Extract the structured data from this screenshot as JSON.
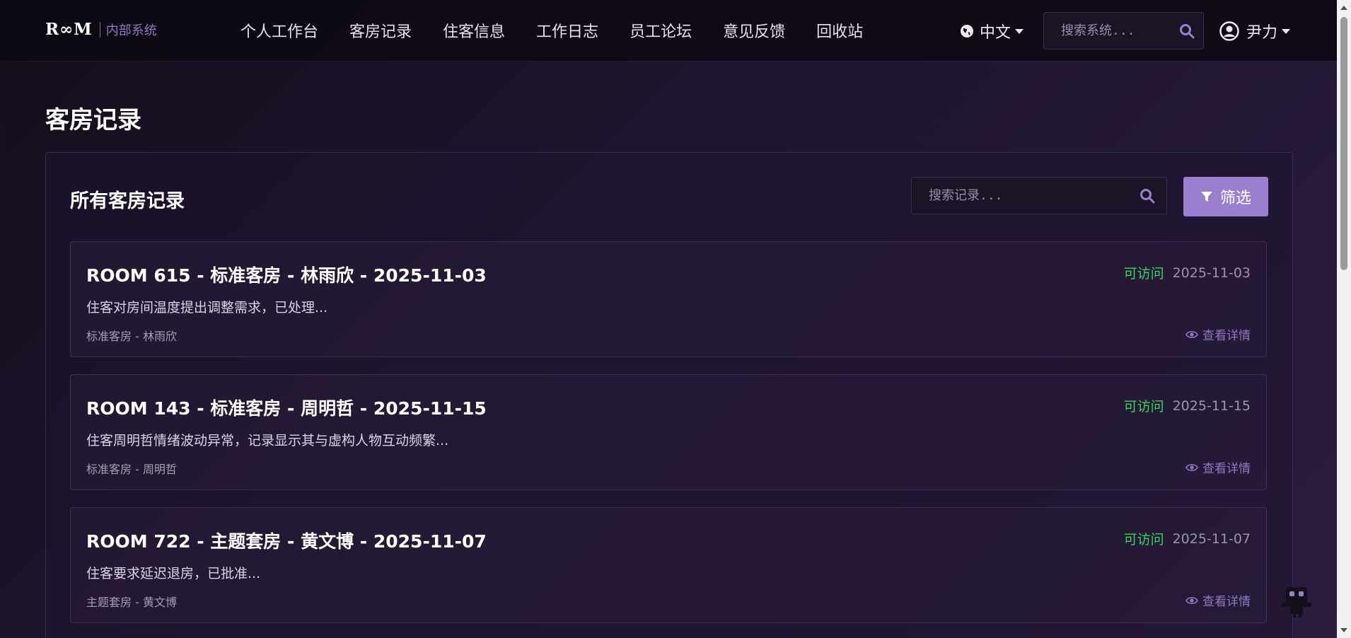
{
  "brand": {
    "logo": "R∞M",
    "subtitle": "内部系统"
  },
  "nav": {
    "links": [
      {
        "label": "个人工作台"
      },
      {
        "label": "客房记录"
      },
      {
        "label": "住客信息"
      },
      {
        "label": "工作日志"
      },
      {
        "label": "员工论坛"
      },
      {
        "label": "意见反馈"
      },
      {
        "label": "回收站"
      }
    ],
    "language": "中文",
    "search_placeholder": "搜索系统...",
    "user": "尹力"
  },
  "page": {
    "title": "客房记录"
  },
  "card": {
    "title": "所有客房记录",
    "search_placeholder": "搜索记录...",
    "filter_label": "筛选"
  },
  "records": [
    {
      "title": "ROOM 615 - 标准客房 - 林雨欣 - 2025-11-03",
      "status": "可访问",
      "date": "2025-11-03",
      "description": "住客对房间温度提出调整需求，已处理...",
      "subtitle": "标准客房 - 林雨欣",
      "view_label": "查看详情"
    },
    {
      "title": "ROOM 143 - 标准客房 - 周明哲 - 2025-11-15",
      "status": "可访问",
      "date": "2025-11-15",
      "description": "住客周明哲情绪波动异常，记录显示其与虚构人物互动频繁...",
      "subtitle": "标准客房 - 周明哲",
      "view_label": "查看详情"
    },
    {
      "title": "ROOM 722 - 主题套房 - 黄文博 - 2025-11-07",
      "status": "可访问",
      "date": "2025-11-07",
      "description": "住客要求延迟退房，已批准...",
      "subtitle": "主题套房 - 黄文博",
      "view_label": "查看详情"
    }
  ],
  "colors": {
    "accent": "#9a7fcf",
    "status_ok": "#39d65a",
    "background": "#1f1530"
  },
  "icons": {
    "language": "globe-icon",
    "search": "search-icon",
    "user": "user-circle-icon",
    "filter": "filter-icon",
    "view": "eye-icon",
    "widget": "robot-icon"
  }
}
